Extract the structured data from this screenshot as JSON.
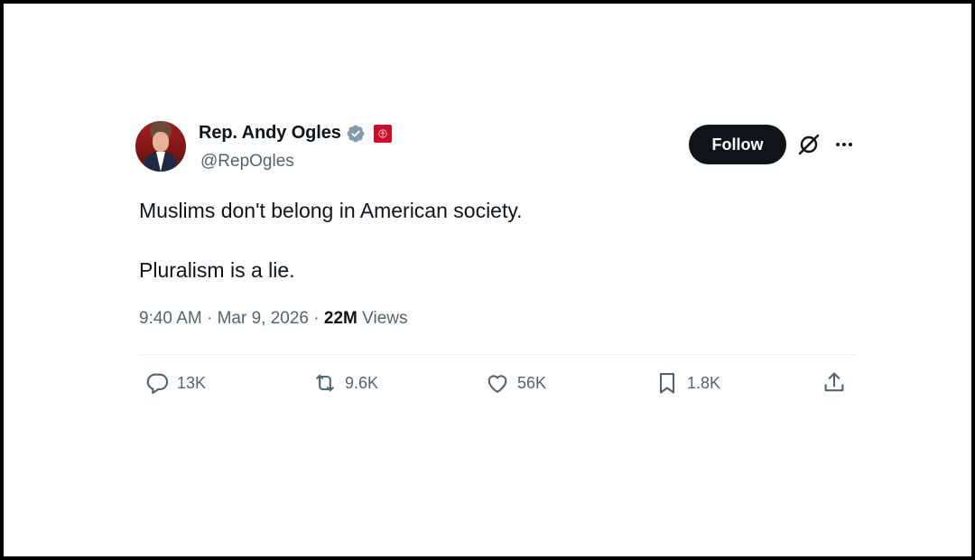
{
  "author": {
    "name": "Rep. Andy Ogles",
    "handle": "@RepOgles",
    "avatar_icon": "profile-photo",
    "verified_icon": "verified-badge-icon",
    "affiliation_icon": "government-badge-icon"
  },
  "header_actions": {
    "follow_label": "Follow",
    "grok_icon": "grok-icon",
    "more_icon": "more-options-icon"
  },
  "tweet": {
    "lines": [
      "Muslims don't belong in American society.",
      "Pluralism is a lie."
    ],
    "time": "9:40 AM",
    "date": "Mar 9, 2026",
    "views_count": "22M",
    "views_label": "Views",
    "separator": "·"
  },
  "actions": {
    "replies": "13K",
    "reposts": "9.6K",
    "likes": "56K",
    "bookmarks": "1.8K"
  },
  "colors": {
    "text": "#0f1419",
    "secondary": "#536471",
    "follow_bg": "#0f1419",
    "divider": "#eff3f4",
    "verified": "#829aab",
    "gov_badge": "#c8102e"
  }
}
